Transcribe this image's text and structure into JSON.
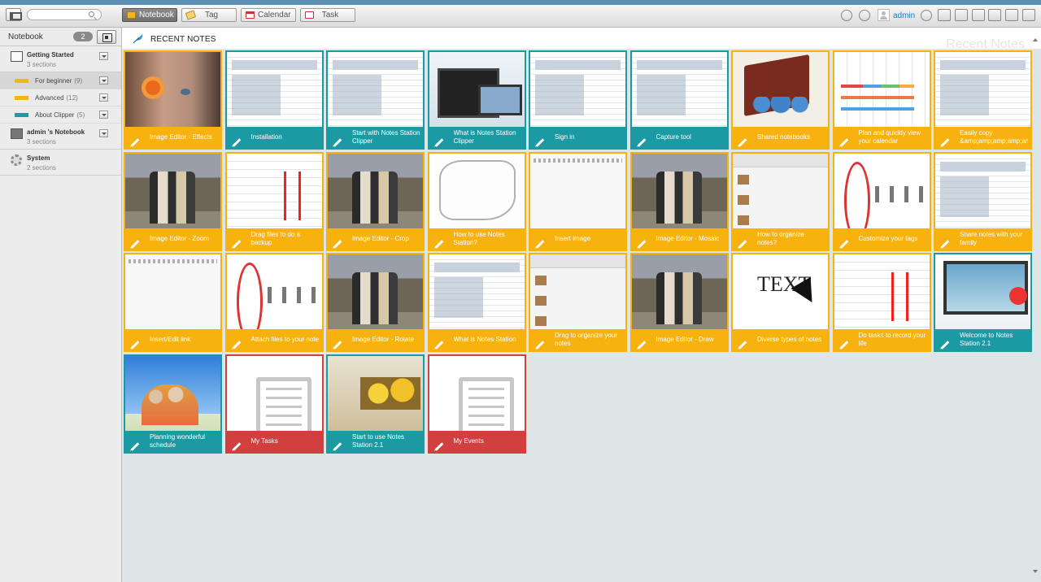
{
  "toolbar": {
    "search_placeholder": "",
    "tabs": [
      {
        "label": "Notebook",
        "icon": "notebook-icon",
        "active": true
      },
      {
        "label": "Tag",
        "icon": "tag-icon",
        "active": false
      },
      {
        "label": "Calendar",
        "icon": "calendar-icon",
        "active": false
      },
      {
        "label": "Task",
        "icon": "task-icon",
        "active": false
      }
    ],
    "username": "admin"
  },
  "sidebar": {
    "header": "Notebook",
    "count": "2",
    "notebooks": [
      {
        "title": "Getting Started",
        "sub": "3 sections",
        "sections": [
          {
            "label": "For beginner",
            "count": "(9)",
            "color": "#f3b519"
          },
          {
            "label": "Advanced",
            "count": "(12)",
            "color": "#f3b519"
          },
          {
            "label": "About Clipper",
            "count": "(5)",
            "color": "#1f9aa5"
          }
        ]
      },
      {
        "title": "admin 's Notebook",
        "sub": "3 sections"
      },
      {
        "title": "System",
        "sub": "2 sections"
      }
    ]
  },
  "main": {
    "title": "RECENT NOTES",
    "watermark": "Recent Notes",
    "notes": [
      {
        "title": "Image Editor - Effects",
        "color": "yellow",
        "thumb": "t-face"
      },
      {
        "title": "Installation",
        "color": "teal",
        "thumb": "t-screen"
      },
      {
        "title": "Start with Notes Station Clipper",
        "color": "teal",
        "thumb": "t-screen"
      },
      {
        "title": "What is Notes Station Clipper",
        "color": "teal",
        "thumb": "t-devices"
      },
      {
        "title": "Sign in",
        "color": "teal",
        "thumb": "t-screen"
      },
      {
        "title": "Capture tool",
        "color": "teal",
        "thumb": "t-screen"
      },
      {
        "title": "Shared notebooks",
        "color": "yellow",
        "thumb": "t-book"
      },
      {
        "title": "Plan and quickly view your calendar",
        "color": "yellow",
        "thumb": "t-cal"
      },
      {
        "title": "Easily copy &amp;amp;amp;amp;amp;am",
        "color": "yellow",
        "thumb": "t-screen"
      },
      {
        "title": "Image Editor - Zoom",
        "color": "yellow",
        "thumb": "t-photo"
      },
      {
        "title": "Drag files to do a backup",
        "color": "yellow",
        "thumb": "t-drag"
      },
      {
        "title": "Image Editor - Crop",
        "color": "yellow",
        "thumb": "t-photo"
      },
      {
        "title": "How to use Notes Station?",
        "color": "yellow",
        "thumb": "t-sketch"
      },
      {
        "title": "Insert image",
        "color": "yellow",
        "thumb": "t-doc"
      },
      {
        "title": "Image Editor - Mosaic",
        "color": "yellow",
        "thumb": "t-photo"
      },
      {
        "title": "How to organize notes?",
        "color": "yellow",
        "thumb": "t-notebooks"
      },
      {
        "title": "Customize your tags",
        "color": "yellow",
        "thumb": "t-tags"
      },
      {
        "title": "Share notes with your family",
        "color": "yellow",
        "thumb": "t-screen"
      },
      {
        "title": "Insert/Edit link",
        "color": "yellow",
        "thumb": "t-doc"
      },
      {
        "title": "Attach files to your note",
        "color": "yellow",
        "thumb": "t-tags"
      },
      {
        "title": "Image Editor - Rotate",
        "color": "yellow",
        "thumb": "t-photo"
      },
      {
        "title": "What is Notes Station",
        "color": "yellow",
        "thumb": "t-screen"
      },
      {
        "title": "Drag to organize your notes",
        "color": "yellow",
        "thumb": "t-notebooks"
      },
      {
        "title": "Image Editor - Draw",
        "color": "yellow",
        "thumb": "t-photo"
      },
      {
        "title": "Diverse types of notes",
        "color": "yellow",
        "thumb": "t-text"
      },
      {
        "title": "Do tasks to record your life",
        "color": "yellow",
        "thumb": "t-drag"
      },
      {
        "title": "Welcome to Notes Station 2.1",
        "color": "teal",
        "thumb": "t-welcome"
      },
      {
        "title": "Planning wonderful schedule",
        "color": "teal",
        "thumb": "t-sky"
      },
      {
        "title": "My Tasks",
        "color": "red",
        "thumb": "t-blank"
      },
      {
        "title": "Start to use Notes Station 2.1",
        "color": "teal",
        "thumb": "t-flower"
      },
      {
        "title": "My Events",
        "color": "red",
        "thumb": "t-blank"
      }
    ]
  }
}
